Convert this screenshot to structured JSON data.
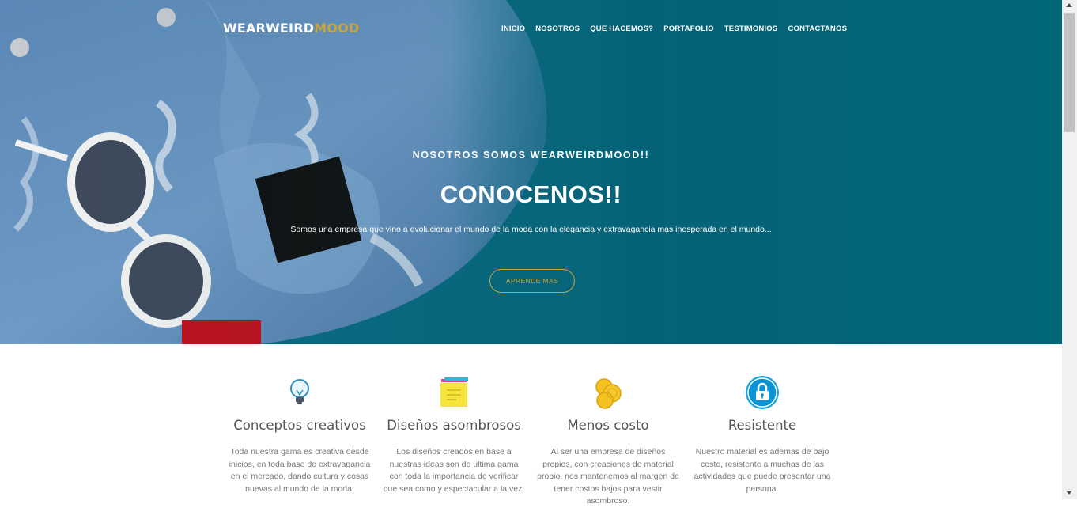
{
  "brand": {
    "name_part1": "WEARWEIRD",
    "name_part2": "MOOD",
    "accent_color": "#c9a43a"
  },
  "nav": {
    "items": [
      {
        "label": "INICIO"
      },
      {
        "label": "NOSOTROS"
      },
      {
        "label": "QUE HACEMOS?"
      },
      {
        "label": "PORTAFOLIO"
      },
      {
        "label": "TESTIMONIOS"
      },
      {
        "label": "CONTACTANOS"
      }
    ]
  },
  "hero": {
    "kicker": "NOSOTROS SOMOS WEARWEIRDMOOD!!",
    "title": "CONOCENOS!!",
    "text": "Somos una empresa que vino a evolucionar el mundo de la moda con la elegancia y extravagancia mas inesperada en el mundo...",
    "button_label": "APRENDE MAS",
    "background_color": "#0a6b80"
  },
  "features": [
    {
      "icon": "lightbulb-icon",
      "title": "Conceptos creativos",
      "text": "Toda nuestra gama es creativa desde inicios, en toda base de extravagancia en el mercado, dando cultura y cosas nuevas al mundo de la moda."
    },
    {
      "icon": "sticky-notes-icon",
      "title": "Diseños asombrosos",
      "text": "Los diseños creados en base a nuestras ideas son de ultima gama con toda la importancia de verificar que sea como y espectacular a la vez."
    },
    {
      "icon": "coins-icon",
      "title": "Menos costo",
      "text": "Al ser una empresa de diseños propios, con creaciones de material propio, nos mantenemos al margen de tener costos bajos para vestir asombroso."
    },
    {
      "icon": "lock-icon",
      "title": "Resistente",
      "text": "Nuestro material es ademas de bajo costo, resistente a muchas de las actividades que puede presentar una persona."
    }
  ]
}
